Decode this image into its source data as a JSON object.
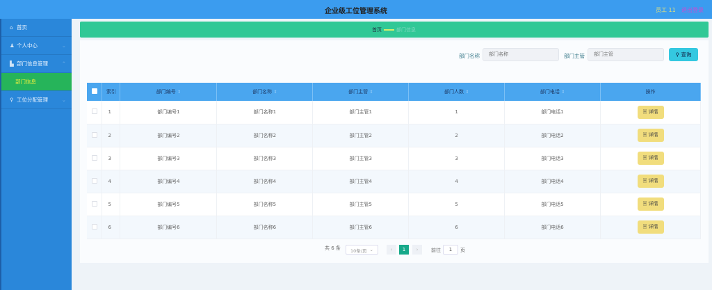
{
  "header": {
    "title": "企业级工位管理系统",
    "user": "员工 11",
    "logout": "退出登录"
  },
  "sidebar": {
    "items": [
      {
        "label": "首页",
        "icon": "home-icon"
      },
      {
        "label": "个人中心",
        "icon": "user-icon"
      },
      {
        "label": "部门信息管理",
        "icon": "building-icon"
      },
      {
        "label": "部门信息",
        "active": true
      },
      {
        "label": "工位分配管理",
        "icon": "pin-icon"
      }
    ]
  },
  "breadcrumb": {
    "home": "首页",
    "current": "部门信息"
  },
  "search": {
    "name_label": "部门名称",
    "name_placeholder": "部门名称",
    "manager_label": "部门主管",
    "manager_placeholder": "部门主管",
    "button": "查询"
  },
  "table": {
    "columns": [
      "索引",
      "部门编号",
      "部门名称",
      "部门主管",
      "部门人数",
      "部门电话",
      "操作"
    ],
    "action_label": "详情",
    "rows": [
      [
        "1",
        "部门编号1",
        "部门名称1",
        "部门主管1",
        "1",
        "部门电话1"
      ],
      [
        "2",
        "部门编号2",
        "部门名称2",
        "部门主管2",
        "2",
        "部门电话2"
      ],
      [
        "3",
        "部门编号3",
        "部门名称3",
        "部门主管3",
        "3",
        "部门电话3"
      ],
      [
        "4",
        "部门编号4",
        "部门名称4",
        "部门主管4",
        "4",
        "部门电话4"
      ],
      [
        "5",
        "部门编号5",
        "部门名称5",
        "部门主管5",
        "5",
        "部门电话5"
      ],
      [
        "6",
        "部门编号6",
        "部门名称6",
        "部门主管6",
        "6",
        "部门电话6"
      ]
    ]
  },
  "pagination": {
    "total": "共 6 条",
    "page_size": "10条/页",
    "current_page": "1",
    "goto_label": "前往",
    "goto_value": "1",
    "page_suffix": "页"
  }
}
